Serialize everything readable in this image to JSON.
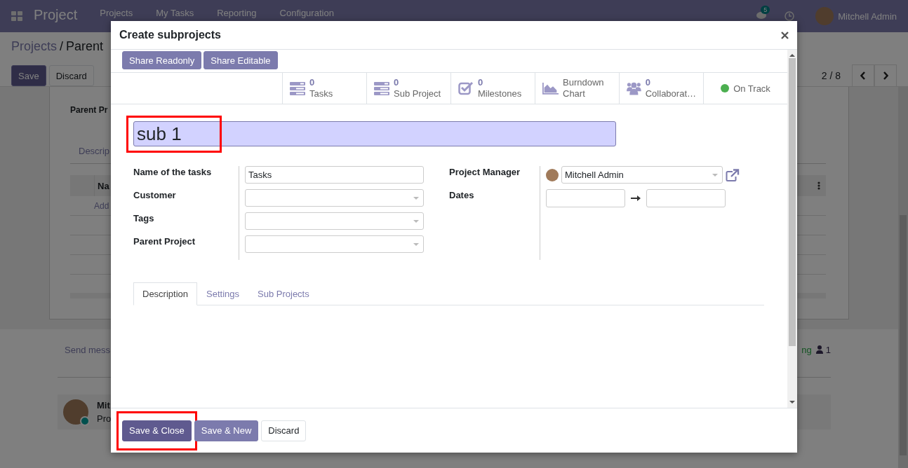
{
  "navbar": {
    "app_name": "Project",
    "menu": [
      "Projects",
      "My Tasks",
      "Reporting",
      "Configuration"
    ],
    "chat_badge": "5",
    "user": "Mitchell Admin"
  },
  "control_panel": {
    "breadcrumb": [
      "Projects",
      "Parent"
    ],
    "breadcrumb_separator": "/",
    "buttons": [
      {
        "label": "Save",
        "kind": "primary"
      },
      {
        "label": "Discard",
        "kind": "secondary"
      }
    ],
    "pager": "2 / 8"
  },
  "form": {
    "field_label": "Parent Pr",
    "tab": "Descrip",
    "table_header": "Na",
    "add_link": "Add"
  },
  "chatter": {
    "send_message": "Send mess",
    "following": "ng",
    "followers": "1",
    "message": {
      "author": "Mit",
      "body": "Pro"
    }
  },
  "dialog": {
    "title": "Create subprojects",
    "share_buttons": [
      "Share Readonly",
      "Share Editable"
    ],
    "stats": [
      {
        "kind": "tasks",
        "value": "0",
        "label": "Tasks"
      },
      {
        "kind": "subprojects",
        "value": "0",
        "label": "Sub Project"
      },
      {
        "kind": "milestones",
        "value": "0",
        "label": "Milestones"
      },
      {
        "kind": "chart",
        "label": "Burndown Chart"
      },
      {
        "kind": "collaborators",
        "value": "0",
        "label": "Collaborat…"
      }
    ],
    "status": "On Track",
    "name": {
      "value": "sub 1",
      "highlighted": true
    },
    "left_fields": [
      {
        "label": "Name of the tasks",
        "kind": "text",
        "value": "Tasks"
      },
      {
        "label": "Customer",
        "kind": "select"
      },
      {
        "label": "Tags",
        "kind": "select"
      },
      {
        "label": "Parent Project",
        "kind": "select"
      }
    ],
    "project_manager": {
      "label": "Project Manager",
      "value": "Mitchell Admin"
    },
    "dates": {
      "label": "Dates"
    },
    "tabs": [
      {
        "label": "Description",
        "selected": true
      },
      {
        "label": "Settings",
        "selected": false
      },
      {
        "label": "Sub Projects",
        "selected": false
      }
    ],
    "footer_buttons": [
      {
        "label": "Save & Close",
        "kind": "primary",
        "focused": true,
        "highlighted": true
      },
      {
        "label": "Save & New",
        "kind": "primary",
        "focused": false,
        "highlighted": false
      },
      {
        "label": "Discard",
        "kind": "secondary",
        "focused": false,
        "highlighted": false
      }
    ]
  }
}
